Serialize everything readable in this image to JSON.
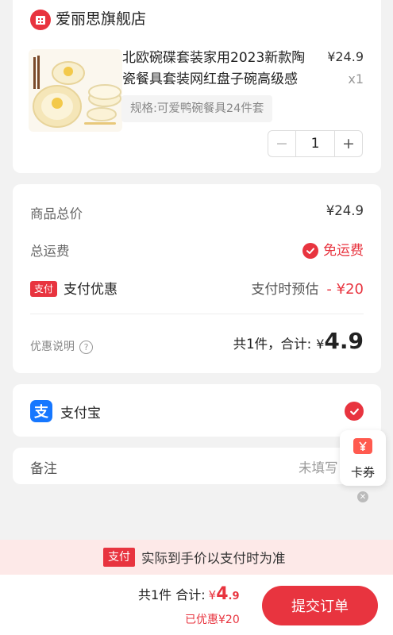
{
  "store": {
    "name": "爱丽思旗舰店",
    "icon": "store-icon"
  },
  "product": {
    "title_line1": "北欧碗碟套装家用2023新款陶",
    "title_line2": "瓷餐具套装网红盘子碗高级感",
    "price": "¥24.9",
    "quantity_label": "x1",
    "spec": "规格:可爱鸭碗餐具24件套",
    "stepper": {
      "minus": "−",
      "value": "1",
      "plus": "+"
    }
  },
  "summary": {
    "total_label": "商品总价",
    "total_value": "¥24.9",
    "shipping_label": "总运费",
    "shipping_value": "免运费",
    "pay_tag": "支付",
    "pay_discount_label": "支付优惠",
    "pay_discount_hint": "支付时预估",
    "pay_discount_value": "- ¥20",
    "discount_note_label": "优惠说明",
    "count_total_label": "共1件，合计:",
    "total_currency": "¥",
    "total_amount": "4.9"
  },
  "payment": {
    "method": "支付宝",
    "icon": "alipay-icon",
    "selected": true
  },
  "remark": {
    "label": "备注",
    "value": "未填写"
  },
  "coupon_float": {
    "label": "卡券",
    "icon": "coupon-icon"
  },
  "notice": {
    "tag": "支付",
    "text": "实际到手价以支付时为准"
  },
  "bottom": {
    "count_label": "共1件 合计:",
    "currency": "¥",
    "amount_int": "4",
    "amount_dec": ".9",
    "saved": "已优惠¥20",
    "submit": "提交订单"
  },
  "colors": {
    "accent": "#e8343f",
    "alipay": "#1677ff",
    "background": "#f2f2f2"
  }
}
